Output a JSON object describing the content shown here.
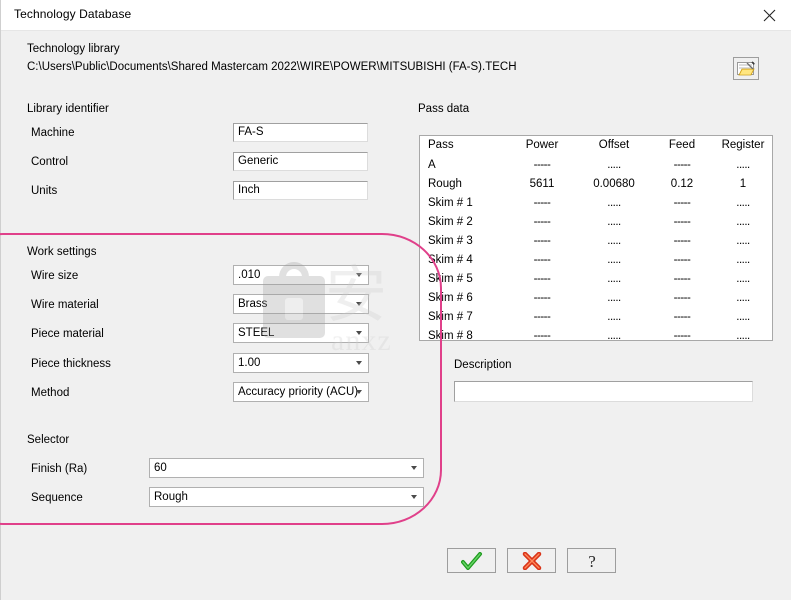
{
  "window": {
    "title": "Technology Database",
    "close_icon": "close-icon"
  },
  "library": {
    "group_label": "Technology library",
    "path": "C:\\Users\\Public\\Documents\\Shared Mastercam 2022\\WIRE\\POWER\\MITSUBISHI (FA-S).TECH",
    "browse_icon": "open-folder-icon"
  },
  "identifier": {
    "group_label": "Library identifier",
    "fields": [
      {
        "label": "Machine",
        "value": "FA-S"
      },
      {
        "label": "Control",
        "value": "Generic"
      },
      {
        "label": "Units",
        "value": "Inch"
      }
    ]
  },
  "work_settings": {
    "group_label": "Work settings",
    "fields": [
      {
        "label": "Wire size",
        "value": ".010"
      },
      {
        "label": "Wire material",
        "value": "Brass"
      },
      {
        "label": "Piece material",
        "value": "STEEL"
      },
      {
        "label": "Piece thickness",
        "value": "1.00"
      },
      {
        "label": "Method",
        "value": "Accuracy priority (ACU)"
      }
    ]
  },
  "selector": {
    "group_label": "Selector",
    "fields": [
      {
        "label": "Finish (Ra)",
        "value": "60"
      },
      {
        "label": "Sequence",
        "value": "Rough"
      }
    ]
  },
  "pass_data": {
    "group_label": "Pass data",
    "columns": [
      "Pass",
      "Power",
      "Offset",
      "Feed",
      "Register"
    ],
    "rows": [
      {
        "pass": "A",
        "power": "-----",
        "offset": ".....",
        "feed": "-----",
        "register": "....."
      },
      {
        "pass": "Rough",
        "power": "5611",
        "offset": "0.00680",
        "feed": "0.12",
        "register": "1"
      },
      {
        "pass": "Skim # 1",
        "power": "-----",
        "offset": ".....",
        "feed": "-----",
        "register": "....."
      },
      {
        "pass": "Skim # 2",
        "power": "-----",
        "offset": ".....",
        "feed": "-----",
        "register": "....."
      },
      {
        "pass": "Skim # 3",
        "power": "-----",
        "offset": ".....",
        "feed": "-----",
        "register": "....."
      },
      {
        "pass": "Skim # 4",
        "power": "-----",
        "offset": ".....",
        "feed": "-----",
        "register": "....."
      },
      {
        "pass": "Skim # 5",
        "power": "-----",
        "offset": ".....",
        "feed": "-----",
        "register": "....."
      },
      {
        "pass": "Skim # 6",
        "power": "-----",
        "offset": ".....",
        "feed": "-----",
        "register": "....."
      },
      {
        "pass": "Skim # 7",
        "power": "-----",
        "offset": ".....",
        "feed": "-----",
        "register": "....."
      },
      {
        "pass": "Skim # 8",
        "power": "-----",
        "offset": ".....",
        "feed": "-----",
        "register": "....."
      }
    ]
  },
  "description": {
    "label": "Description",
    "value": "",
    "placeholder": ""
  },
  "buttons": [
    {
      "name": "ok-button",
      "icon": "green-check-icon"
    },
    {
      "name": "cancel-button",
      "icon": "red-x-icon"
    },
    {
      "name": "help-button",
      "icon": "question-mark-icon"
    }
  ],
  "watermark": {
    "cn": "安",
    "text": "anxz"
  },
  "colors": {
    "dialog_bg": "#f0f0f0",
    "titlebar_bg": "#ffffff",
    "annotation": "#e0408a",
    "field_bg": "#ffffff"
  }
}
